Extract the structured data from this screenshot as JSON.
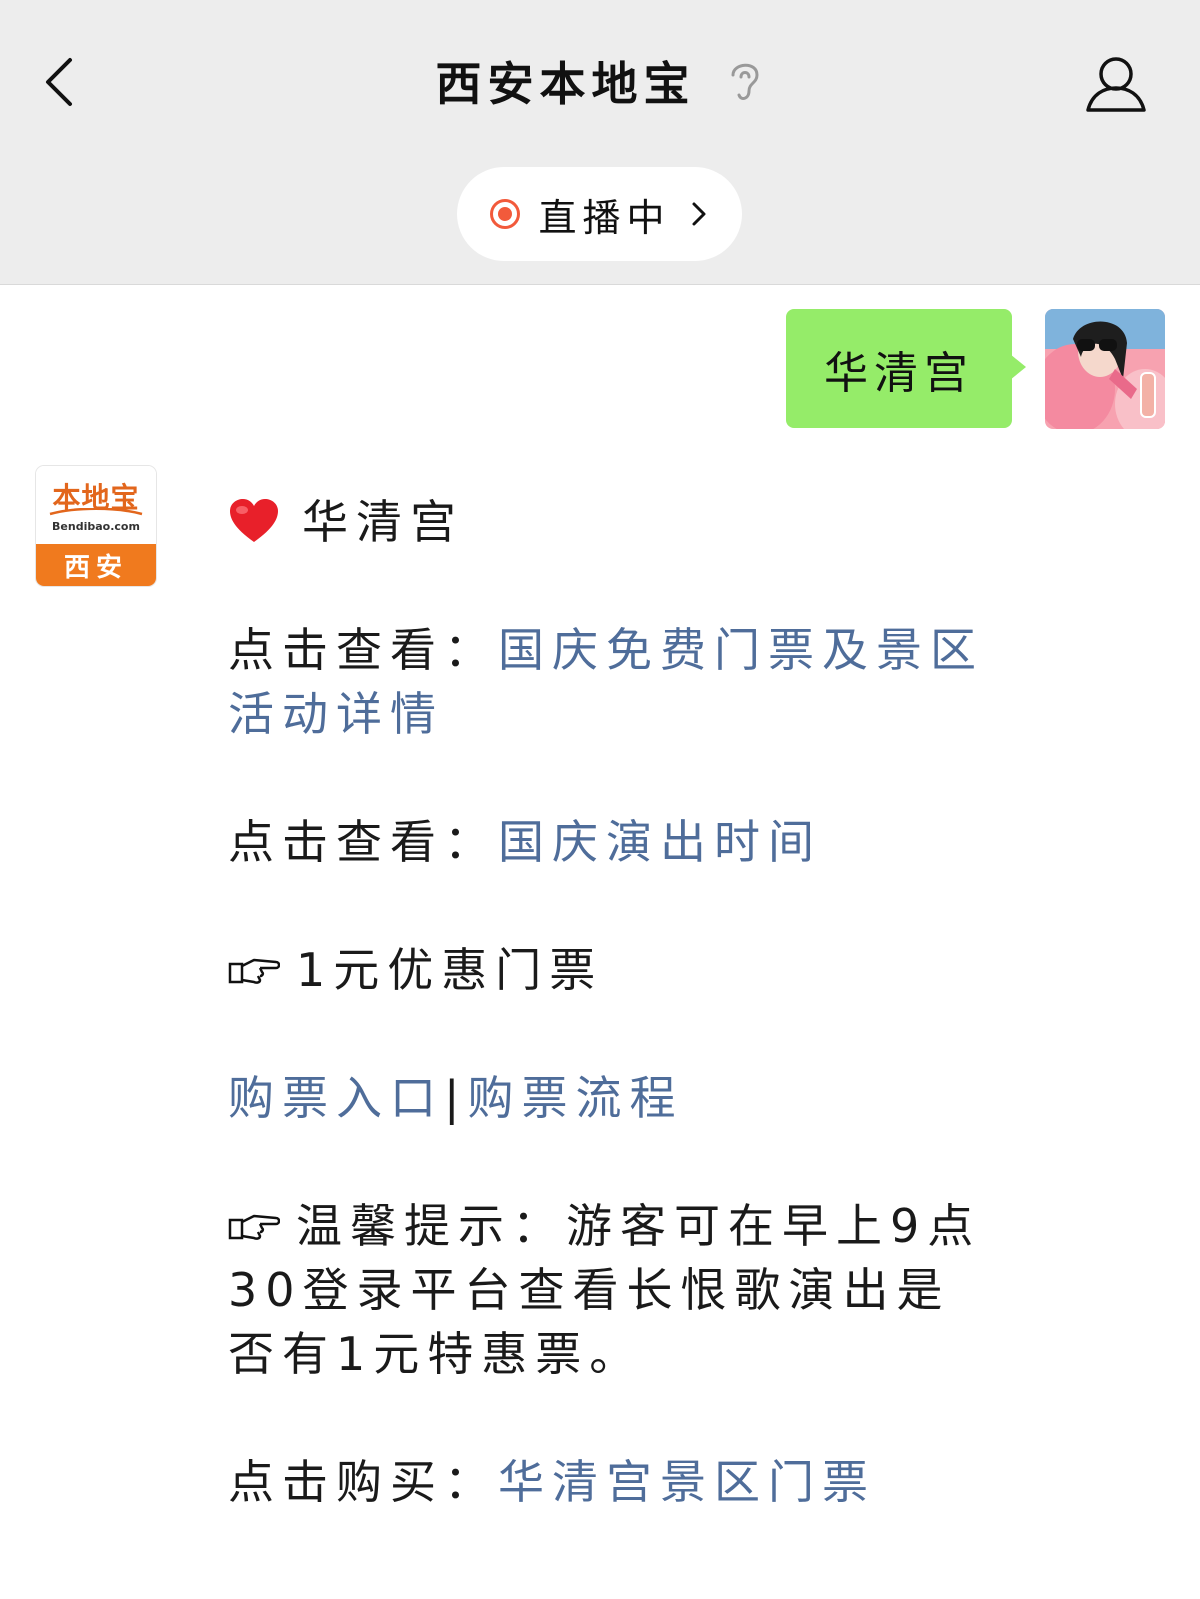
{
  "header": {
    "title": "西安本地宝",
    "live_label": "直播中"
  },
  "chat": {
    "user_message": "华清宫",
    "bot_avatar": {
      "logo_text": "本地宝",
      "site_text": "Bendibao.com",
      "city": "西安"
    },
    "reply": {
      "headline": "华清宫",
      "line1_prefix": "点击查看：",
      "line1_link": "国庆免费门票及景区活动详情",
      "line2_prefix": "点击查看：",
      "line2_link": "国庆演出时间",
      "line3_text": "1元优惠门票",
      "buy_link1": "购票入口",
      "separator": "|",
      "buy_link2": "购票流程",
      "tip_text": "温馨提示：游客可在早上9点30登录平台查看长恨歌演出是否有1元特惠票。",
      "line5_prefix": "点击购买：",
      "line5_link": "华清宫景区门票"
    }
  },
  "colors": {
    "header_bg": "#ededed",
    "live_red": "#f25a3b",
    "bubble_green": "#95ec69",
    "link_blue": "#4f6d9a",
    "brand_orange": "#f07a1e"
  }
}
